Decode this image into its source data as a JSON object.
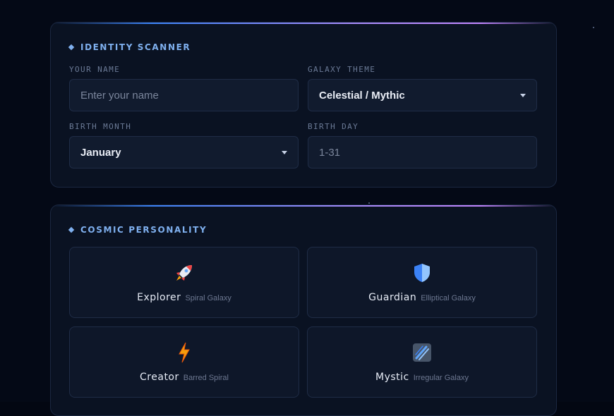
{
  "identity": {
    "title": "IDENTITY SCANNER",
    "name": {
      "label": "YOUR NAME",
      "placeholder": "Enter your name",
      "value": ""
    },
    "theme": {
      "label": "GALAXY THEME",
      "value": "Celestial / Mythic"
    },
    "month": {
      "label": "BIRTH MONTH",
      "value": "January"
    },
    "day": {
      "label": "BIRTH DAY",
      "placeholder": "1-31",
      "value": ""
    }
  },
  "personality": {
    "title": "COSMIC PERSONALITY",
    "options": [
      {
        "name": "Explorer",
        "sub": "Spiral Galaxy",
        "icon": "rocket-icon"
      },
      {
        "name": "Guardian",
        "sub": "Elliptical Galaxy",
        "icon": "shield-icon"
      },
      {
        "name": "Creator",
        "sub": "Barred Spiral",
        "icon": "lightning-icon"
      },
      {
        "name": "Mystic",
        "sub": "Irregular Galaxy",
        "icon": "comet-icon"
      }
    ]
  },
  "colors": {
    "accent": "#7fb0ef",
    "panel": "#0a1222",
    "field": "#111b2e",
    "background": "#040916"
  }
}
